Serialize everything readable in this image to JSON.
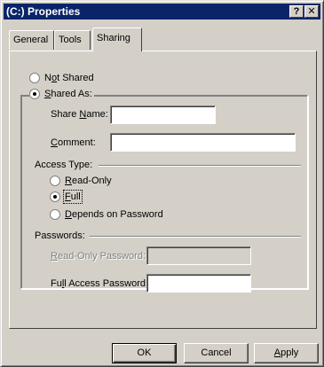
{
  "window": {
    "title": "(C:) Properties",
    "help_label": "?",
    "close_label": "✕"
  },
  "tabs": [
    {
      "label": "General"
    },
    {
      "label": "Tools"
    },
    {
      "label": "Sharing",
      "active": true
    }
  ],
  "sharing": {
    "not_shared": {
      "pre": "N",
      "u": "o",
      "post": "t Shared",
      "checked": false
    },
    "shared_as": {
      "pre": "",
      "u": "S",
      "post": "hared As:",
      "checked": true
    },
    "share_name_label": {
      "pre": "Share ",
      "u": "N",
      "post": "ame:"
    },
    "share_name_value": "",
    "comment_label": {
      "pre": "",
      "u": "C",
      "post": "omment:"
    },
    "comment_value": "",
    "access_type_label": "Access Type:",
    "access_options": [
      {
        "pre": "",
        "u": "R",
        "post": "ead-Only",
        "checked": false
      },
      {
        "pre": "",
        "u": "F",
        "post": "ull",
        "checked": true
      },
      {
        "pre": "",
        "u": "D",
        "post": "epends on Password",
        "checked": false
      }
    ],
    "passwords_label": "Passwords:",
    "readonly_password_label": {
      "pre": "",
      "u": "R",
      "post": "ead-Only Password:"
    },
    "readonly_password_value": "",
    "full_password_label": {
      "pre": "Fu",
      "u": "l",
      "post": "l Access Password:"
    },
    "full_password_value": ""
  },
  "buttons": {
    "ok": "OK",
    "cancel": "Cancel",
    "apply": {
      "pre": "",
      "u": "A",
      "post": "pply"
    }
  }
}
